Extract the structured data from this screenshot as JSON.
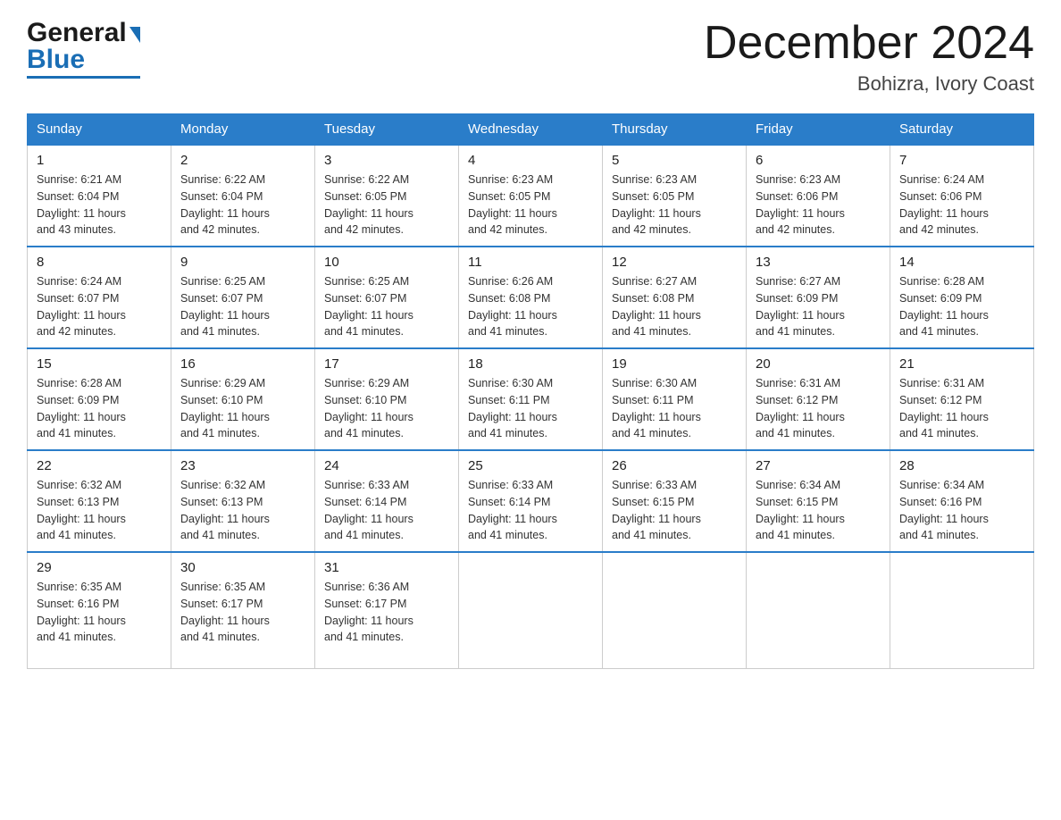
{
  "header": {
    "logo_general": "General",
    "logo_blue": "Blue",
    "month_title": "December 2024",
    "location": "Bohizra, Ivory Coast"
  },
  "weekdays": [
    "Sunday",
    "Monday",
    "Tuesday",
    "Wednesday",
    "Thursday",
    "Friday",
    "Saturday"
  ],
  "weeks": [
    [
      {
        "day": "1",
        "sunrise": "6:21 AM",
        "sunset": "6:04 PM",
        "daylight": "11 hours and 43 minutes."
      },
      {
        "day": "2",
        "sunrise": "6:22 AM",
        "sunset": "6:04 PM",
        "daylight": "11 hours and 42 minutes."
      },
      {
        "day": "3",
        "sunrise": "6:22 AM",
        "sunset": "6:05 PM",
        "daylight": "11 hours and 42 minutes."
      },
      {
        "day": "4",
        "sunrise": "6:23 AM",
        "sunset": "6:05 PM",
        "daylight": "11 hours and 42 minutes."
      },
      {
        "day": "5",
        "sunrise": "6:23 AM",
        "sunset": "6:05 PM",
        "daylight": "11 hours and 42 minutes."
      },
      {
        "day": "6",
        "sunrise": "6:23 AM",
        "sunset": "6:06 PM",
        "daylight": "11 hours and 42 minutes."
      },
      {
        "day": "7",
        "sunrise": "6:24 AM",
        "sunset": "6:06 PM",
        "daylight": "11 hours and 42 minutes."
      }
    ],
    [
      {
        "day": "8",
        "sunrise": "6:24 AM",
        "sunset": "6:07 PM",
        "daylight": "11 hours and 42 minutes."
      },
      {
        "day": "9",
        "sunrise": "6:25 AM",
        "sunset": "6:07 PM",
        "daylight": "11 hours and 41 minutes."
      },
      {
        "day": "10",
        "sunrise": "6:25 AM",
        "sunset": "6:07 PM",
        "daylight": "11 hours and 41 minutes."
      },
      {
        "day": "11",
        "sunrise": "6:26 AM",
        "sunset": "6:08 PM",
        "daylight": "11 hours and 41 minutes."
      },
      {
        "day": "12",
        "sunrise": "6:27 AM",
        "sunset": "6:08 PM",
        "daylight": "11 hours and 41 minutes."
      },
      {
        "day": "13",
        "sunrise": "6:27 AM",
        "sunset": "6:09 PM",
        "daylight": "11 hours and 41 minutes."
      },
      {
        "day": "14",
        "sunrise": "6:28 AM",
        "sunset": "6:09 PM",
        "daylight": "11 hours and 41 minutes."
      }
    ],
    [
      {
        "day": "15",
        "sunrise": "6:28 AM",
        "sunset": "6:09 PM",
        "daylight": "11 hours and 41 minutes."
      },
      {
        "day": "16",
        "sunrise": "6:29 AM",
        "sunset": "6:10 PM",
        "daylight": "11 hours and 41 minutes."
      },
      {
        "day": "17",
        "sunrise": "6:29 AM",
        "sunset": "6:10 PM",
        "daylight": "11 hours and 41 minutes."
      },
      {
        "day": "18",
        "sunrise": "6:30 AM",
        "sunset": "6:11 PM",
        "daylight": "11 hours and 41 minutes."
      },
      {
        "day": "19",
        "sunrise": "6:30 AM",
        "sunset": "6:11 PM",
        "daylight": "11 hours and 41 minutes."
      },
      {
        "day": "20",
        "sunrise": "6:31 AM",
        "sunset": "6:12 PM",
        "daylight": "11 hours and 41 minutes."
      },
      {
        "day": "21",
        "sunrise": "6:31 AM",
        "sunset": "6:12 PM",
        "daylight": "11 hours and 41 minutes."
      }
    ],
    [
      {
        "day": "22",
        "sunrise": "6:32 AM",
        "sunset": "6:13 PM",
        "daylight": "11 hours and 41 minutes."
      },
      {
        "day": "23",
        "sunrise": "6:32 AM",
        "sunset": "6:13 PM",
        "daylight": "11 hours and 41 minutes."
      },
      {
        "day": "24",
        "sunrise": "6:33 AM",
        "sunset": "6:14 PM",
        "daylight": "11 hours and 41 minutes."
      },
      {
        "day": "25",
        "sunrise": "6:33 AM",
        "sunset": "6:14 PM",
        "daylight": "11 hours and 41 minutes."
      },
      {
        "day": "26",
        "sunrise": "6:33 AM",
        "sunset": "6:15 PM",
        "daylight": "11 hours and 41 minutes."
      },
      {
        "day": "27",
        "sunrise": "6:34 AM",
        "sunset": "6:15 PM",
        "daylight": "11 hours and 41 minutes."
      },
      {
        "day": "28",
        "sunrise": "6:34 AM",
        "sunset": "6:16 PM",
        "daylight": "11 hours and 41 minutes."
      }
    ],
    [
      {
        "day": "29",
        "sunrise": "6:35 AM",
        "sunset": "6:16 PM",
        "daylight": "11 hours and 41 minutes."
      },
      {
        "day": "30",
        "sunrise": "6:35 AM",
        "sunset": "6:17 PM",
        "daylight": "11 hours and 41 minutes."
      },
      {
        "day": "31",
        "sunrise": "6:36 AM",
        "sunset": "6:17 PM",
        "daylight": "11 hours and 41 minutes."
      },
      null,
      null,
      null,
      null
    ]
  ],
  "labels": {
    "sunrise": "Sunrise:",
    "sunset": "Sunset:",
    "daylight": "Daylight:"
  }
}
